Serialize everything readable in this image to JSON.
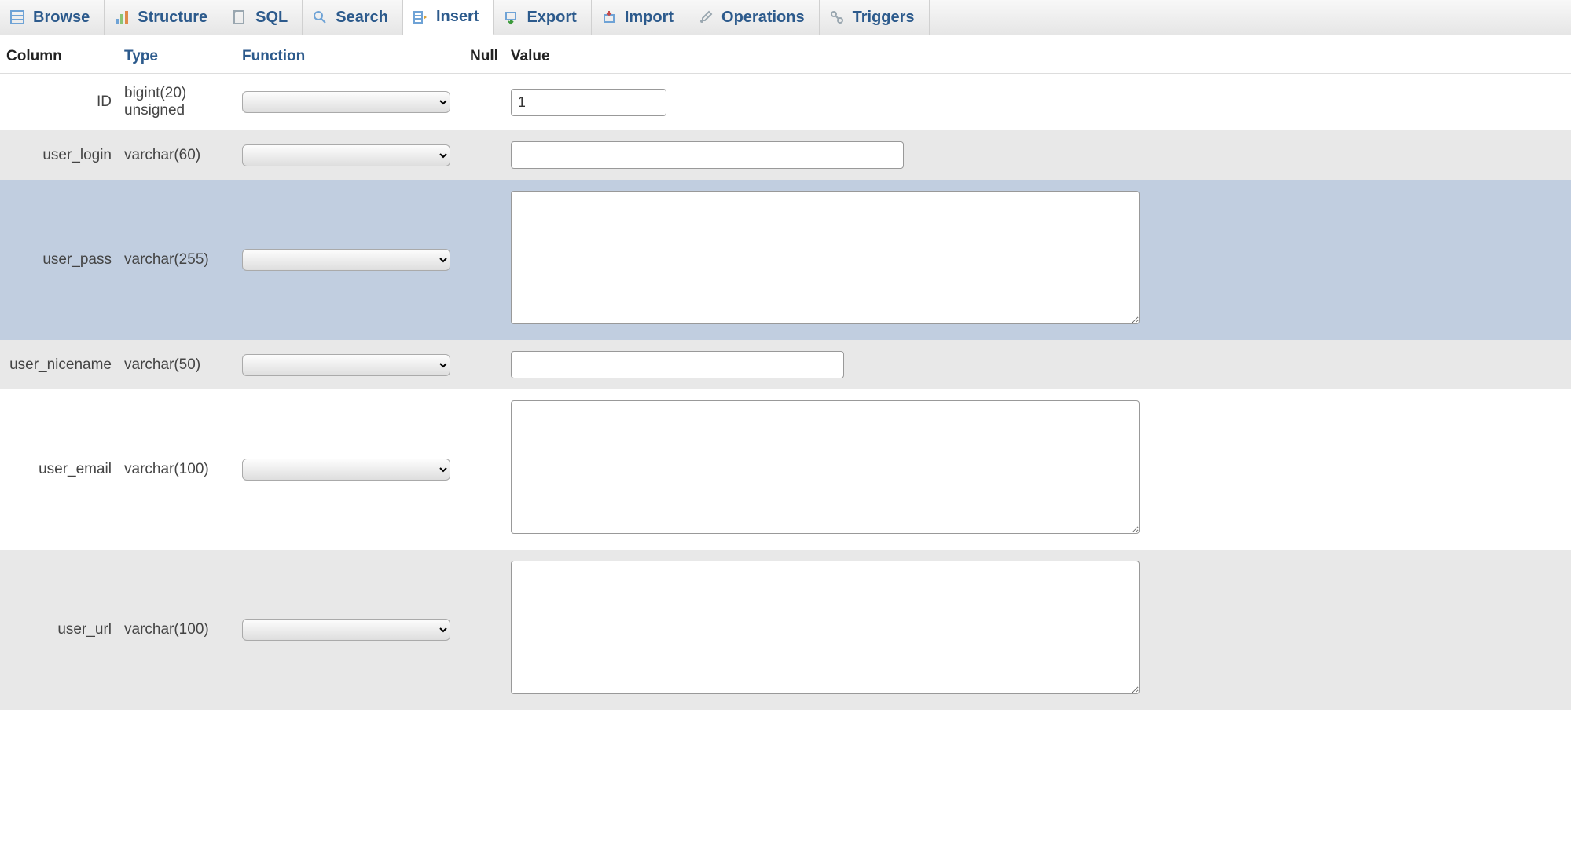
{
  "tabs": [
    {
      "label": "Browse",
      "icon": "browse-icon"
    },
    {
      "label": "Structure",
      "icon": "structure-icon"
    },
    {
      "label": "SQL",
      "icon": "sql-icon"
    },
    {
      "label": "Search",
      "icon": "search-icon"
    },
    {
      "label": "Insert",
      "icon": "insert-icon",
      "active": true
    },
    {
      "label": "Export",
      "icon": "export-icon"
    },
    {
      "label": "Import",
      "icon": "import-icon"
    },
    {
      "label": "Operations",
      "icon": "operations-icon"
    },
    {
      "label": "Triggers",
      "icon": "triggers-icon"
    }
  ],
  "headers": {
    "column": "Column",
    "type": "Type",
    "function": "Function",
    "null": "Null",
    "value": "Value"
  },
  "rows": [
    {
      "column": "ID",
      "type": "bigint(20) unsigned",
      "value_kind": "input",
      "value": "1",
      "width": "w-id",
      "row_style": ""
    },
    {
      "column": "user_login",
      "type": "varchar(60)",
      "value_kind": "input",
      "value": "",
      "width": "w-login",
      "row_style": "row-odd",
      "redacted": true
    },
    {
      "column": "user_pass",
      "type": "varchar(255)",
      "value_kind": "textarea",
      "value": "",
      "row_style": "row-highlight",
      "redacted": true
    },
    {
      "column": "user_nicename",
      "type": "varchar(50)",
      "value_kind": "input",
      "value": "",
      "width": "w-nice",
      "row_style": "row-odd",
      "redacted": true
    },
    {
      "column": "user_email",
      "type": "varchar(100)",
      "value_kind": "textarea",
      "value": "",
      "row_style": "",
      "redacted": true
    },
    {
      "column": "user_url",
      "type": "varchar(100)",
      "value_kind": "textarea",
      "value": "",
      "row_style": "row-odd",
      "redacted": true
    }
  ]
}
